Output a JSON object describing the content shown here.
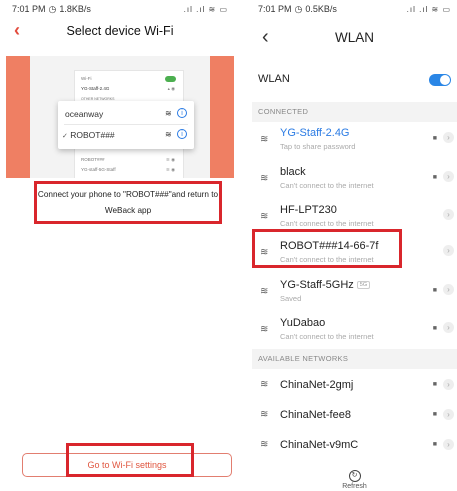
{
  "left": {
    "status": {
      "time": "7:01 PM",
      "speed": "1.8KB/s",
      "icons": ".ıl .ıl ≋ ▭"
    },
    "header": {
      "title": "Select device Wi-Fi",
      "back_icon": "‹"
    },
    "illustration": {
      "mini_rows": [
        "Wi-Fi",
        "YG-Staff-2.4G",
        "OTHER NETWORKS",
        "",
        "",
        "ROBOT###",
        "YG-staff-5G-Staff"
      ],
      "popup_rows": [
        {
          "name": "oceanway",
          "check": ""
        },
        {
          "name": "ROBOT###",
          "check": "✓"
        }
      ]
    },
    "instruction": "Connect your phone to \"ROBOT###\"and return to WeBack app",
    "go_button": "Go to Wi-Fi settings"
  },
  "right": {
    "status": {
      "time": "7:01 PM",
      "speed": "0.5KB/s",
      "icons": ".ıl .ıl ≋ ▭"
    },
    "header": {
      "title": "WLAN",
      "back_icon": "‹"
    },
    "wlan_label": "WLAN",
    "wlan_on": true,
    "connected_label": "CONNECTED",
    "available_label": "AVAILABLE NETWORKS",
    "refresh_label": "Refresh",
    "networks": [
      {
        "name": "YG-Staff-2.4G",
        "sub": "Tap to share password",
        "connected": true,
        "locked": true
      },
      {
        "name": "black",
        "sub": "Can't connect to the internet",
        "locked": true
      },
      {
        "name": "HF-LPT230",
        "sub": "Can't connect to the internet",
        "locked": false
      },
      {
        "name": "ROBOT###14-66-7f",
        "sub": "Can't connect to the internet",
        "locked": false
      },
      {
        "name": "YG-Staff-5GHz",
        "badge": "5G",
        "sub": "Saved",
        "locked": true
      },
      {
        "name": "YuDabao",
        "sub": "Can't connect to the internet",
        "locked": true
      }
    ],
    "available": [
      {
        "name": "ChinaNet-2gmj",
        "locked": true
      },
      {
        "name": "ChinaNet-fee8",
        "locked": true
      },
      {
        "name": "ChinaNet-v9mC",
        "locked": true
      }
    ]
  }
}
